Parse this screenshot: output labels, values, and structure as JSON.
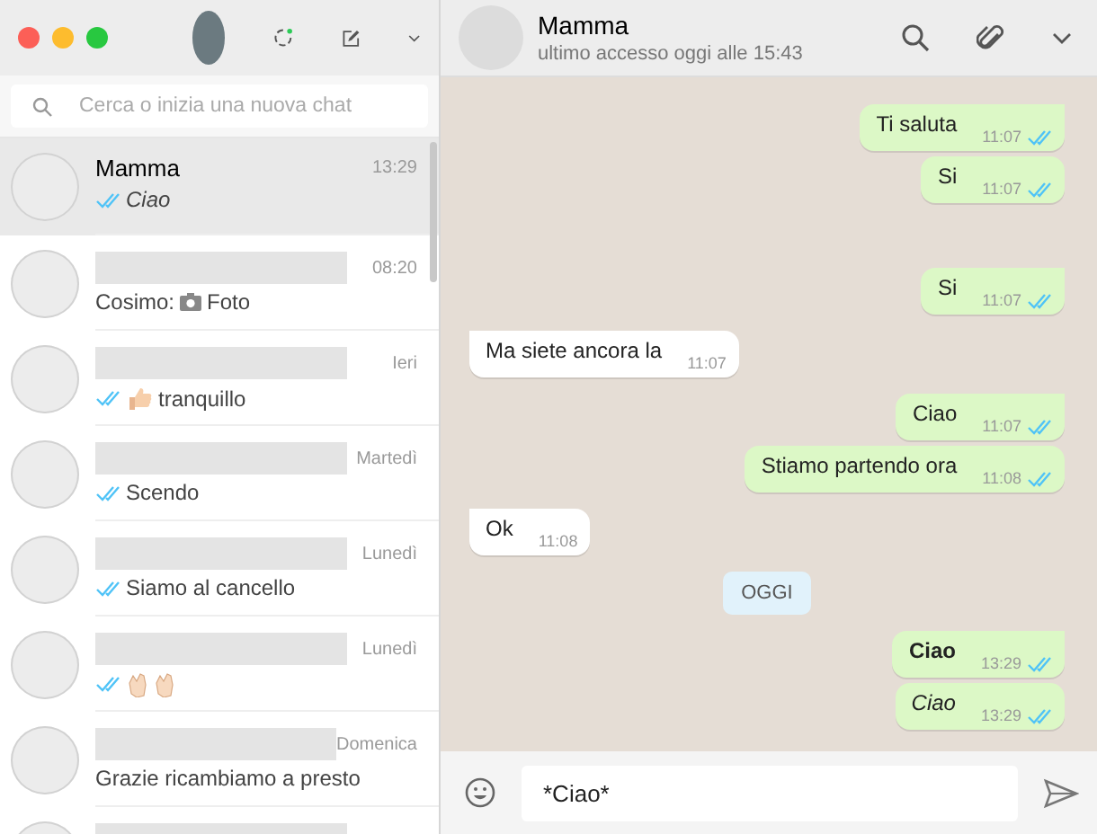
{
  "search": {
    "placeholder": "Cerca o inizia una nuova chat"
  },
  "chats": [
    {
      "kind": "text",
      "name": "Mamma",
      "name_hidden": false,
      "time": "13:29",
      "ticks": true,
      "preview": "Ciao",
      "italic": true,
      "selected": true
    },
    {
      "kind": "photo",
      "name_hidden": true,
      "time": "08:20",
      "ticks": false,
      "sender": "Cosimo:",
      "preview": "Foto",
      "italic": false,
      "selected": false
    },
    {
      "kind": "thumbs",
      "name_hidden": true,
      "time": "Ieri",
      "ticks": true,
      "preview": "tranquillo",
      "italic": false,
      "selected": false
    },
    {
      "kind": "text",
      "name_hidden": true,
      "time": "Martedì",
      "ticks": true,
      "preview": "Scendo",
      "italic": false,
      "selected": false
    },
    {
      "kind": "text",
      "name_hidden": true,
      "time": "Lunedì",
      "ticks": true,
      "preview": "Siamo al cancello",
      "italic": false,
      "selected": false
    },
    {
      "kind": "clap",
      "name_hidden": true,
      "time": "Lunedì",
      "ticks": true,
      "selected": false
    },
    {
      "kind": "text",
      "name_hidden": true,
      "time": "Domenica",
      "ticks": false,
      "preview": "Grazie ricambiamo a presto",
      "italic": false,
      "selected": false
    },
    {
      "kind": "text",
      "name_hidden": true,
      "selected": false
    }
  ],
  "conversation": {
    "name": "Mamma",
    "status": "ultimo accesso oggi alle 15:43"
  },
  "messages": [
    {
      "kind": "out",
      "text": "Ti saluta",
      "time": "11:07",
      "bold": false,
      "italic": false,
      "first": true
    },
    {
      "kind": "out",
      "text": "Si",
      "time": "11:07",
      "bold": false,
      "italic": false,
      "first": false
    },
    {
      "kind": "out",
      "text": "Si",
      "time": "11:07",
      "bold": false,
      "italic": false,
      "first": true
    },
    {
      "kind": "in",
      "text": "Ma siete ancora la",
      "time": "11:07",
      "bold": false,
      "italic": false,
      "first": true
    },
    {
      "kind": "out",
      "text": "Ciao",
      "time": "11:07",
      "bold": false,
      "italic": false,
      "first": true
    },
    {
      "kind": "out",
      "text": "Stiamo partendo ora",
      "time": "11:08",
      "bold": false,
      "italic": false,
      "first": false
    },
    {
      "kind": "in",
      "text": "Ok",
      "time": "11:08",
      "bold": false,
      "italic": false,
      "first": true
    },
    {
      "kind": "day",
      "text": "OGGI"
    },
    {
      "kind": "out",
      "text": "Ciao",
      "time": "13:29",
      "bold": true,
      "italic": false,
      "first": true
    },
    {
      "kind": "out",
      "text": "Ciao",
      "time": "13:29",
      "bold": false,
      "italic": true,
      "first": false
    }
  ],
  "composer": {
    "value": "*Ciao*"
  }
}
